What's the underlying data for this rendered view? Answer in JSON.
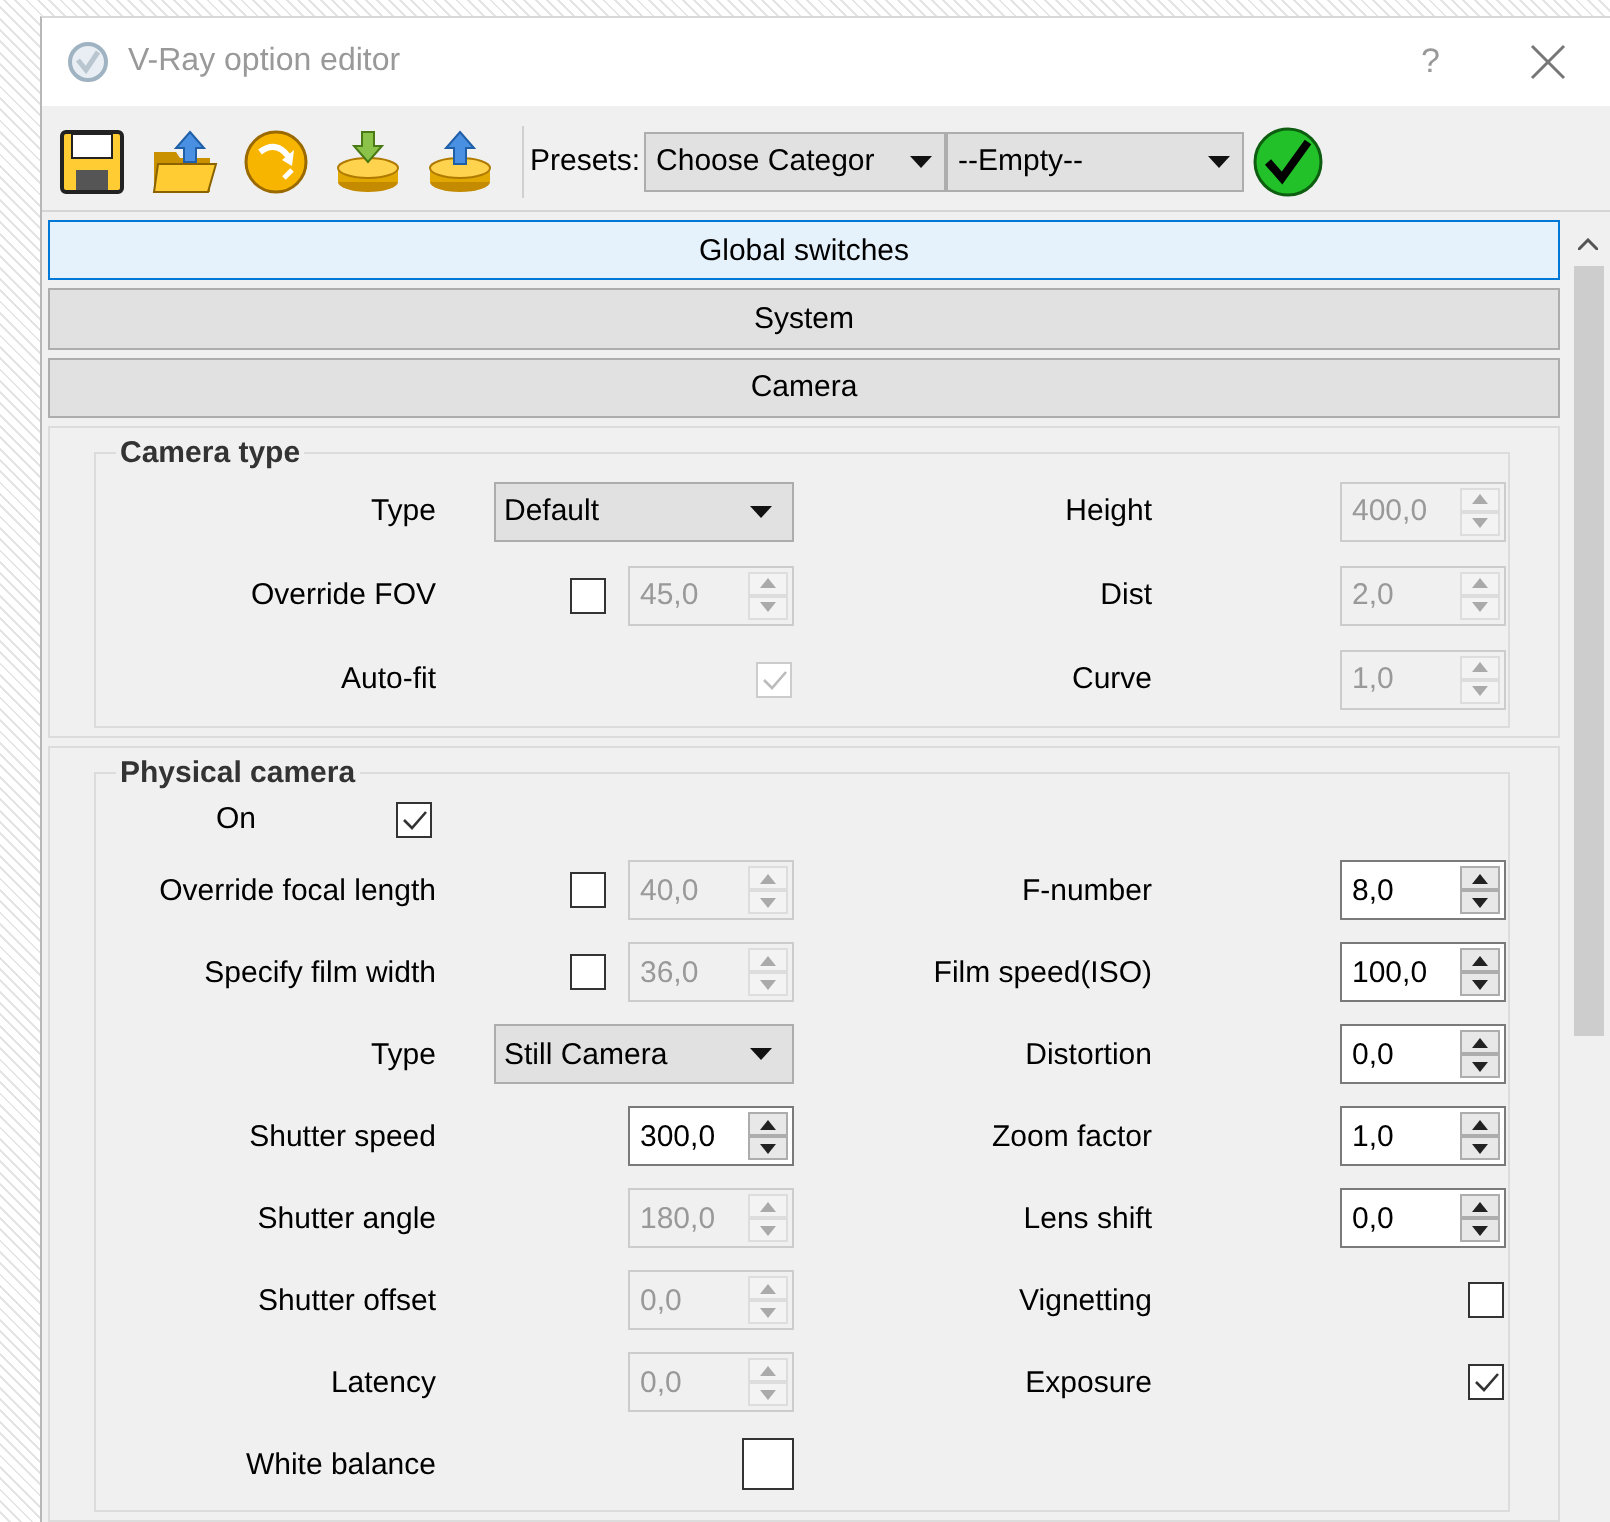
{
  "window": {
    "title": "V-Ray option editor",
    "help": "?"
  },
  "toolbar": {
    "presets_label": "Presets:",
    "category": "Choose Categor",
    "preset": "--Empty--"
  },
  "sections": [
    {
      "label": "Global switches",
      "selected": true
    },
    {
      "label": "System",
      "selected": false
    },
    {
      "label": "Camera",
      "selected": false
    }
  ],
  "groups": [
    {
      "title": "Camera type",
      "rows": [
        {
          "left": {
            "label": "Type",
            "kind": "dropdown",
            "value": "Default"
          },
          "right": {
            "label": "Height",
            "kind": "spin",
            "value": "400,0",
            "disabled": true
          }
        },
        {
          "left": {
            "label": "Override FOV",
            "kind": "check_spin",
            "checked": false,
            "value": "45,0",
            "disabled": true
          },
          "right": {
            "label": "Dist",
            "kind": "spin",
            "value": "2,0",
            "disabled": true
          }
        },
        {
          "left": {
            "label": "Auto-fit",
            "kind": "check",
            "checked": true,
            "disabled": true
          },
          "right": {
            "label": "Curve",
            "kind": "spin",
            "value": "1,0",
            "disabled": true
          }
        }
      ]
    },
    {
      "title": "Physical camera",
      "enable": {
        "label": "On",
        "checked": true
      },
      "rows": [
        {
          "left": {
            "label": "Override focal length",
            "kind": "check_spin",
            "checked": false,
            "value": "40,0",
            "disabled": true
          },
          "right": {
            "label": "F-number",
            "kind": "spin",
            "value": "8,0",
            "disabled": false
          }
        },
        {
          "left": {
            "label": "Specify film width",
            "kind": "check_spin",
            "checked": false,
            "value": "36,0",
            "disabled": true
          },
          "right": {
            "label": "Film speed(ISO)",
            "kind": "spin",
            "value": "100,0",
            "disabled": false
          }
        },
        {
          "left": {
            "label": "Type",
            "kind": "dropdown",
            "value": "Still Camera"
          },
          "right": {
            "label": "Distortion",
            "kind": "spin",
            "value": "0,0",
            "disabled": false
          }
        },
        {
          "left": {
            "label": "Shutter speed",
            "kind": "spin",
            "value": "300,0",
            "disabled": false
          },
          "right": {
            "label": "Zoom factor",
            "kind": "spin",
            "value": "1,0",
            "disabled": false
          }
        },
        {
          "left": {
            "label": "Shutter angle",
            "kind": "spin",
            "value": "180,0",
            "disabled": true
          },
          "right": {
            "label": "Lens shift",
            "kind": "spin",
            "value": "0,0",
            "disabled": false
          }
        },
        {
          "left": {
            "label": "Shutter offset",
            "kind": "spin",
            "value": "0,0",
            "disabled": true
          },
          "right": {
            "label": "Vignetting",
            "kind": "check",
            "checked": false,
            "disabled": false
          }
        },
        {
          "left": {
            "label": "Latency",
            "kind": "spin",
            "value": "0,0",
            "disabled": true
          },
          "right": {
            "label": "Exposure",
            "kind": "check",
            "checked": true,
            "disabled": false
          }
        },
        {
          "left": {
            "label": "White balance",
            "kind": "swatch",
            "color": "#ffffff"
          }
        }
      ]
    }
  ]
}
